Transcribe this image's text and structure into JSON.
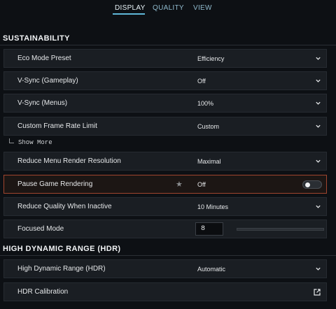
{
  "tabs": [
    {
      "label": "DISPLAY"
    },
    {
      "label": "QUALITY"
    },
    {
      "label": "VIEW"
    }
  ],
  "active_tab": "DISPLAY",
  "sections": [
    {
      "title": "SUSTAINABILITY"
    },
    {
      "title": "HIGH DYNAMIC RANGE (HDR)"
    }
  ],
  "rows": {
    "eco_mode": {
      "label": "Eco Mode Preset",
      "value": "Efficiency"
    },
    "vsync_gameplay": {
      "label": "V-Sync (Gameplay)",
      "value": "Off"
    },
    "vsync_menus": {
      "label": "V-Sync (Menus)",
      "value": "100%"
    },
    "frame_limit": {
      "label": "Custom Frame Rate Limit",
      "value": "Custom"
    },
    "reduce_menu_res": {
      "label": "Reduce Menu Render Resolution",
      "value": "Maximal"
    },
    "pause_rendering": {
      "label": "Pause Game Rendering",
      "value": "Off",
      "toggle_on": false
    },
    "reduce_quality": {
      "label": "Reduce Quality When Inactive",
      "value": "10 Minutes"
    },
    "focused_mode": {
      "label": "Focused Mode",
      "value": "8",
      "slider_fraction": 0.0
    },
    "hdr": {
      "label": "High Dynamic Range (HDR)",
      "value": "Automatic"
    },
    "hdr_calibration": {
      "label": "HDR Calibration"
    }
  },
  "show_more": {
    "label": "Show More"
  },
  "icons": {
    "dropdown": "chevron-down-icon",
    "favorite": "star-icon",
    "external": "external-link-icon"
  },
  "colors": {
    "accent": "#5fb8d8",
    "highlight_border": "#a0452e",
    "background": "#0d1014",
    "row_background": "#1a1e23"
  }
}
